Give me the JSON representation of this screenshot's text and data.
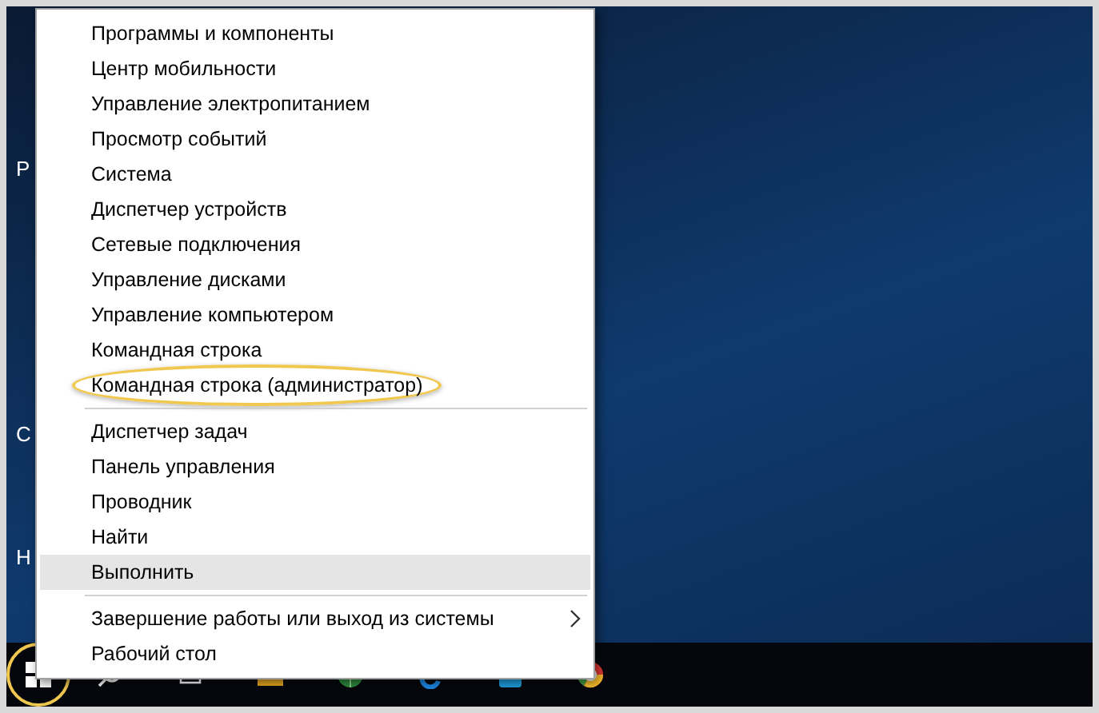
{
  "desktop_icons": [
    {
      "label": "Р"
    },
    {
      "label": "С"
    },
    {
      "label": "Н"
    }
  ],
  "context_menu": {
    "groups": [
      {
        "items": [
          {
            "label": "Программы и компоненты",
            "selected": false,
            "circled": false,
            "submenu": false
          },
          {
            "label": "Центр мобильности",
            "selected": false,
            "circled": false,
            "submenu": false
          },
          {
            "label": "Управление электропитанием",
            "selected": false,
            "circled": false,
            "submenu": false
          },
          {
            "label": "Просмотр событий",
            "selected": false,
            "circled": false,
            "submenu": false
          },
          {
            "label": "Система",
            "selected": false,
            "circled": false,
            "submenu": false
          },
          {
            "label": "Диспетчер устройств",
            "selected": false,
            "circled": false,
            "submenu": false
          },
          {
            "label": "Сетевые подключения",
            "selected": false,
            "circled": false,
            "submenu": false
          },
          {
            "label": "Управление дисками",
            "selected": false,
            "circled": false,
            "submenu": false
          },
          {
            "label": "Управление компьютером",
            "selected": false,
            "circled": false,
            "submenu": false
          },
          {
            "label": "Командная строка",
            "selected": false,
            "circled": false,
            "submenu": false
          },
          {
            "label": "Командная строка (администратор)",
            "selected": false,
            "circled": true,
            "submenu": false
          }
        ]
      },
      {
        "items": [
          {
            "label": "Диспетчер задач",
            "selected": false,
            "circled": false,
            "submenu": false
          },
          {
            "label": "Панель управления",
            "selected": false,
            "circled": false,
            "submenu": false
          },
          {
            "label": "Проводник",
            "selected": false,
            "circled": false,
            "submenu": false
          },
          {
            "label": "Найти",
            "selected": false,
            "circled": false,
            "submenu": false
          },
          {
            "label": "Выполнить",
            "selected": true,
            "circled": false,
            "submenu": false
          }
        ]
      },
      {
        "items": [
          {
            "label": "Завершение работы или выход из системы",
            "selected": false,
            "circled": false,
            "submenu": true
          },
          {
            "label": "Рабочий стол",
            "selected": false,
            "circled": false,
            "submenu": false
          }
        ]
      }
    ]
  },
  "taskbar": {
    "start_circled": true,
    "apps": [
      {
        "kind": "search"
      },
      {
        "kind": "taskview"
      },
      {
        "kind": "folder"
      },
      {
        "kind": "globe"
      },
      {
        "kind": "edge"
      },
      {
        "kind": "store"
      },
      {
        "kind": "chrome"
      }
    ]
  }
}
